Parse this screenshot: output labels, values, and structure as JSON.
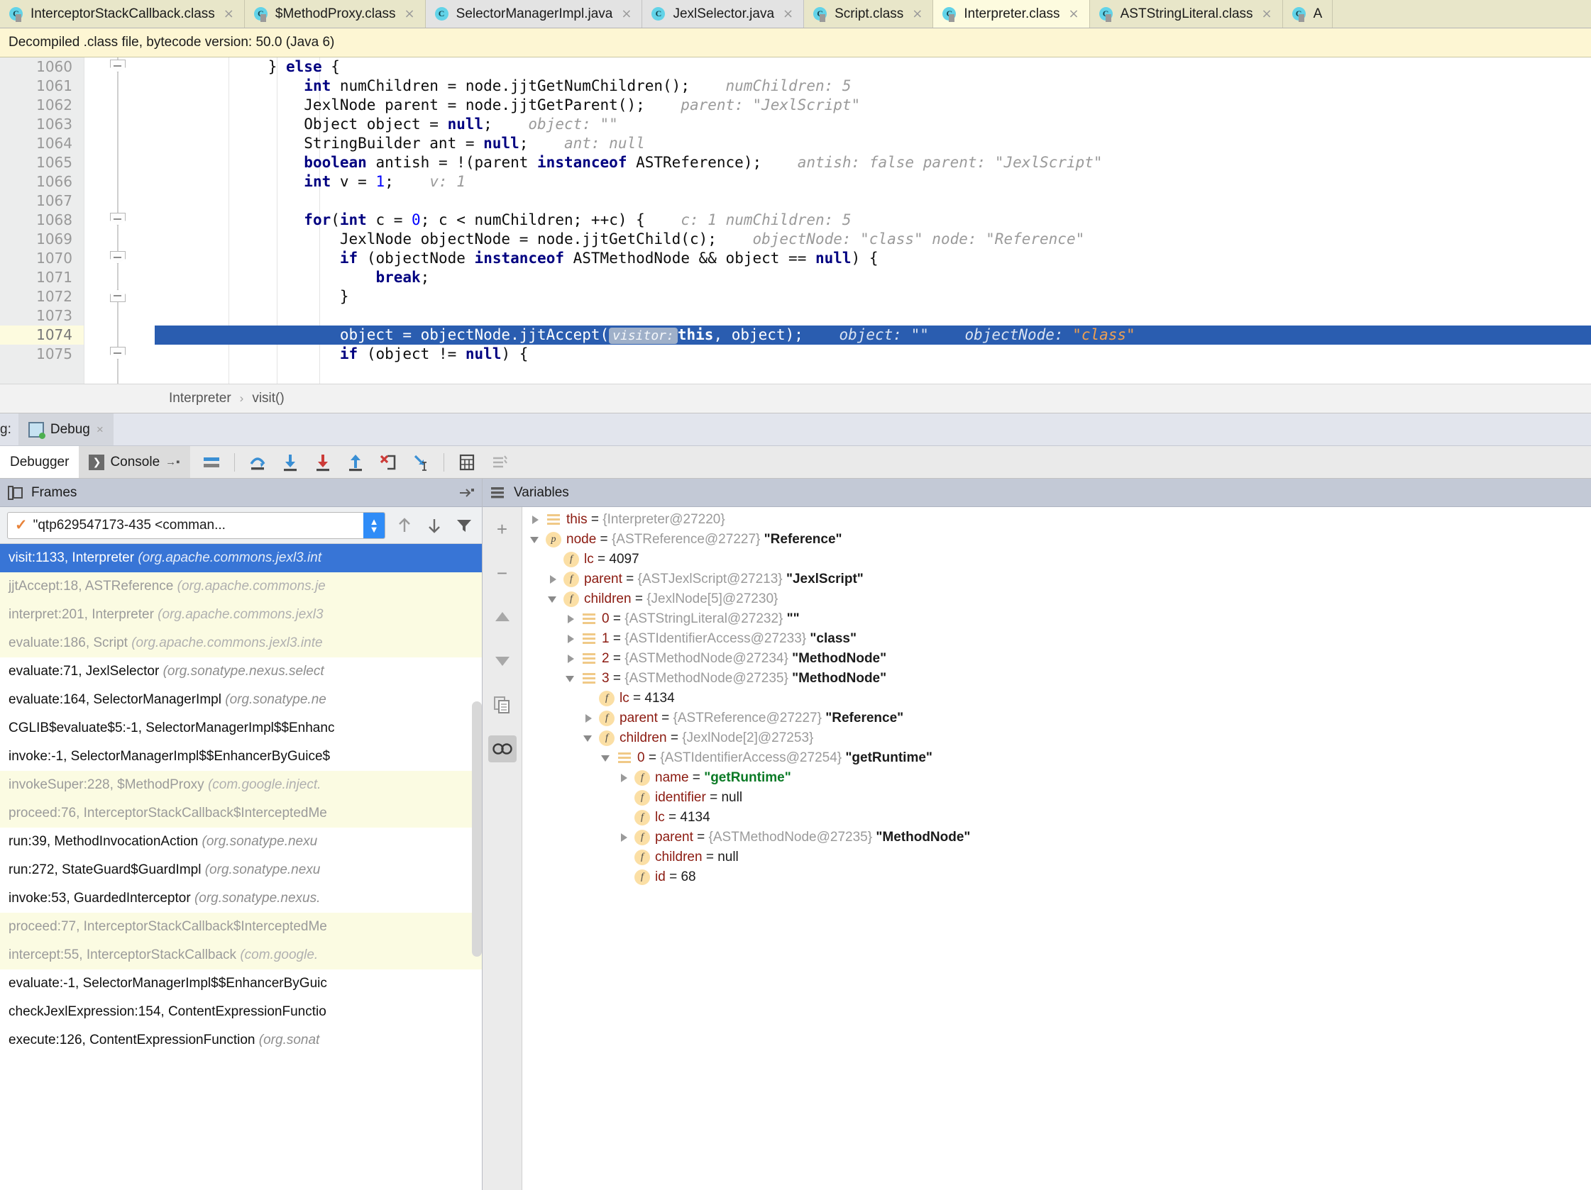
{
  "tabs": [
    {
      "label": "InterceptorStackCallback.class",
      "kind": "cls",
      "icon": "class-icon",
      "closable": true,
      "selected": false
    },
    {
      "label": "$MethodProxy.class",
      "kind": "cls",
      "icon": "class-icon",
      "closable": true,
      "selected": false
    },
    {
      "label": "SelectorManagerImpl.java",
      "kind": "java",
      "icon": "class-icon",
      "closable": true,
      "selected": false
    },
    {
      "label": "JexlSelector.java",
      "kind": "java",
      "icon": "class-icon",
      "closable": true,
      "selected": false
    },
    {
      "label": "Script.class",
      "kind": "cls",
      "icon": "class-icon",
      "closable": true,
      "selected": false
    },
    {
      "label": "Interpreter.class",
      "kind": "sel",
      "icon": "class-icon",
      "closable": true,
      "selected": true
    },
    {
      "label": "ASTStringLiteral.class",
      "kind": "cls",
      "icon": "class-icon",
      "closable": true,
      "selected": false
    },
    {
      "label": "A",
      "kind": "cls",
      "icon": "class-icon",
      "closable": false,
      "selected": false
    }
  ],
  "notification": {
    "text": "Decompiled .class file, bytecode version: 50.0 (Java 6)"
  },
  "editor": {
    "first_line": 1060,
    "current_line": 1074,
    "lines": [
      {
        "n": 1060,
        "fold": "down"
      },
      {
        "n": 1061
      },
      {
        "n": 1062
      },
      {
        "n": 1063
      },
      {
        "n": 1064
      },
      {
        "n": 1065
      },
      {
        "n": 1066
      },
      {
        "n": 1067
      },
      {
        "n": 1068,
        "fold": "down"
      },
      {
        "n": 1069
      },
      {
        "n": 1070,
        "fold": "down"
      },
      {
        "n": 1071
      },
      {
        "n": 1072,
        "fold": "up"
      },
      {
        "n": 1073
      },
      {
        "n": 1074,
        "highlighted": true
      },
      {
        "n": 1075,
        "fold": "down"
      }
    ],
    "code_text": [
      "} else {",
      "int numChildren = node.jjtGetNumChildren();",
      "JexlNode parent = node.jjtGetParent();",
      "Object object = null;",
      "StringBuilder ant = null;",
      "boolean antish = !(parent instanceof ASTReference);",
      "int v = 1;",
      "",
      "for(int c = 0; c < numChildren; ++c) {",
      "JexlNode objectNode = node.jjtGetChild(c);",
      "if (objectNode instanceof ASTMethodNode && object == null) {",
      "break;",
      "}",
      "",
      "object = objectNode.jjtAccept(visitor: this, object);",
      "if (object != null) {"
    ],
    "inline_hints": [
      {
        "line": 1061,
        "text": "numChildren: 5"
      },
      {
        "line": 1062,
        "text": "parent: \"JexlScript\""
      },
      {
        "line": 1063,
        "text": "object: \"\""
      },
      {
        "line": 1064,
        "text": "ant: null"
      },
      {
        "line": 1065,
        "text": "antish: false     parent: \"JexlScript\""
      },
      {
        "line": 1066,
        "text": "v: 1"
      },
      {
        "line": 1068,
        "text": "c: 1   numChildren: 5"
      },
      {
        "line": 1069,
        "text": "objectNode: \"class\"    node: \"Reference\""
      },
      {
        "line": 1074,
        "text": "object: \"\"    objectNode: \"class\""
      }
    ],
    "param_hint_label": "visitor:"
  },
  "breadcrumb": {
    "items": [
      "Interpreter",
      "visit()"
    ],
    "separator": "›"
  },
  "debug_window": {
    "label": "g:",
    "tab_label": "Debug",
    "close_label": "×",
    "tabs": [
      {
        "label": "Debugger",
        "active": true
      },
      {
        "label": "Console",
        "active": false
      }
    ],
    "toolbar_icons": [
      "show-execution-point-icon",
      "step-over-icon",
      "step-into-icon",
      "force-step-into-icon",
      "step-out-icon",
      "drop-frame-icon",
      "run-to-cursor-icon",
      "evaluate-expression-icon",
      "settings-icon"
    ]
  },
  "frames": {
    "title": "Frames",
    "thread": {
      "name": "\"qtp629547173-435 <comman...",
      "check": "✓"
    },
    "toolbar_icons": [
      "arrow-up-icon",
      "arrow-down-icon",
      "filter-icon"
    ],
    "items": [
      {
        "method": "visit:1133, Interpreter",
        "pkg": "(org.apache.commons.jexl3.int",
        "style": "sel"
      },
      {
        "method": "jjtAccept:18, ASTReference",
        "pkg": "(org.apache.commons.je",
        "style": "lib"
      },
      {
        "method": "interpret:201, Interpreter",
        "pkg": "(org.apache.commons.jexl3",
        "style": "lib"
      },
      {
        "method": "evaluate:186, Script",
        "pkg": "(org.apache.commons.jexl3.inte",
        "style": "lib"
      },
      {
        "method": "evaluate:71, JexlSelector",
        "pkg": "(org.sonatype.nexus.select",
        "style": "usr"
      },
      {
        "method": "evaluate:164, SelectorManagerImpl",
        "pkg": "(org.sonatype.ne",
        "style": "usr"
      },
      {
        "method": "CGLIB$evaluate$5:-1, SelectorManagerImpl$$Enhanc",
        "pkg": "",
        "style": "usr"
      },
      {
        "method": "invoke:-1, SelectorManagerImpl$$EnhancerByGuice$",
        "pkg": "",
        "style": "usr"
      },
      {
        "method": "invokeSuper:228, $MethodProxy",
        "pkg": "(com.google.inject.",
        "style": "lib"
      },
      {
        "method": "proceed:76, InterceptorStackCallback$InterceptedMe",
        "pkg": "",
        "style": "lib"
      },
      {
        "method": "run:39, MethodInvocationAction",
        "pkg": "(org.sonatype.nexu",
        "style": "usr"
      },
      {
        "method": "run:272, StateGuard$GuardImpl",
        "pkg": "(org.sonatype.nexu",
        "style": "usr"
      },
      {
        "method": "invoke:53, GuardedInterceptor",
        "pkg": "(org.sonatype.nexus.",
        "style": "usr"
      },
      {
        "method": "proceed:77, InterceptorStackCallback$InterceptedMe",
        "pkg": "",
        "style": "lib"
      },
      {
        "method": "intercept:55, InterceptorStackCallback",
        "pkg": "(com.google.",
        "style": "lib"
      },
      {
        "method": "evaluate:-1, SelectorManagerImpl$$EnhancerByGuic",
        "pkg": "",
        "style": "usr"
      },
      {
        "method": "checkJexlExpression:154, ContentExpressionFunctio",
        "pkg": "",
        "style": "usr"
      },
      {
        "method": "execute:126, ContentExpressionFunction",
        "pkg": "(org.sonat",
        "style": "usr"
      }
    ]
  },
  "variables": {
    "title": "Variables",
    "sidebar_icons": [
      "plus-icon",
      "minus-icon",
      "arrow-up-icon",
      "arrow-down-icon",
      "copy-icon",
      "watches-icon"
    ],
    "rows": [
      {
        "indent": 0,
        "twisty": "closed",
        "icon": "obj",
        "name": "this",
        "eq": " = ",
        "ref": "{Interpreter@27220}",
        "str": ""
      },
      {
        "indent": 0,
        "twisty": "open",
        "icon": "p",
        "name": "node",
        "eq": " = ",
        "ref": "{ASTReference@27227}",
        "str": "\"Reference\""
      },
      {
        "indent": 1,
        "twisty": "none",
        "icon": "f",
        "name": "lc",
        "eq": " = ",
        "ref": "",
        "num": "4097"
      },
      {
        "indent": 1,
        "twisty": "closed",
        "icon": "f",
        "name": "parent",
        "eq": " = ",
        "ref": "{ASTJexlScript@27213}",
        "str": "\"JexlScript\""
      },
      {
        "indent": 1,
        "twisty": "open",
        "icon": "f",
        "name": "children",
        "eq": " = ",
        "ref": "{JexlNode[5]@27230}",
        "str": ""
      },
      {
        "indent": 2,
        "twisty": "closed",
        "icon": "obj",
        "name": "0",
        "eq": " = ",
        "ref": "{ASTStringLiteral@27232}",
        "str": "\"\""
      },
      {
        "indent": 2,
        "twisty": "closed",
        "icon": "obj",
        "name": "1",
        "eq": " = ",
        "ref": "{ASTIdentifierAccess@27233}",
        "str": "\"class\""
      },
      {
        "indent": 2,
        "twisty": "closed",
        "icon": "obj",
        "name": "2",
        "eq": " = ",
        "ref": "{ASTMethodNode@27234}",
        "str": "\"MethodNode\""
      },
      {
        "indent": 2,
        "twisty": "open",
        "icon": "obj",
        "name": "3",
        "eq": " = ",
        "ref": "{ASTMethodNode@27235}",
        "str": "\"MethodNode\""
      },
      {
        "indent": 3,
        "twisty": "none",
        "icon": "f",
        "name": "lc",
        "eq": " = ",
        "ref": "",
        "num": "4134"
      },
      {
        "indent": 3,
        "twisty": "closed",
        "icon": "f",
        "name": "parent",
        "eq": " = ",
        "ref": "{ASTReference@27227}",
        "str": "\"Reference\""
      },
      {
        "indent": 3,
        "twisty": "open",
        "icon": "f",
        "name": "children",
        "eq": " = ",
        "ref": "{JexlNode[2]@27253}",
        "str": ""
      },
      {
        "indent": 4,
        "twisty": "open",
        "icon": "obj",
        "name": "0",
        "eq": " = ",
        "ref": "{ASTIdentifierAccess@27254}",
        "str": "\"getRuntime\""
      },
      {
        "indent": 5,
        "twisty": "closed",
        "icon": "f",
        "name": "name",
        "eq": " = ",
        "ref": "",
        "strgreen": "\"getRuntime\""
      },
      {
        "indent": 5,
        "twisty": "none",
        "icon": "f",
        "name": "identifier",
        "eq": " = ",
        "ref": "",
        "nul": "null"
      },
      {
        "indent": 5,
        "twisty": "none",
        "icon": "f",
        "name": "lc",
        "eq": " = ",
        "ref": "",
        "num": "4134"
      },
      {
        "indent": 5,
        "twisty": "closed",
        "icon": "f",
        "name": "parent",
        "eq": " = ",
        "ref": "{ASTMethodNode@27235}",
        "str": "\"MethodNode\""
      },
      {
        "indent": 5,
        "twisty": "none",
        "icon": "f",
        "name": "children",
        "eq": " = ",
        "ref": "",
        "nul": "null"
      },
      {
        "indent": 5,
        "twisty": "none",
        "icon": "f",
        "name": "id",
        "eq": " = ",
        "ref": "",
        "num": "68"
      }
    ]
  },
  "colors": {
    "tab_selected": "#fdfbdf",
    "notification_bg": "#fdf6d3",
    "selection_blue": "#2a5db0",
    "frame_selected": "#3875d6",
    "library_frame": "#fbfbe2",
    "keyword": "#000080",
    "string_green": "#0a7a25",
    "var_name": "#8b1a10"
  }
}
